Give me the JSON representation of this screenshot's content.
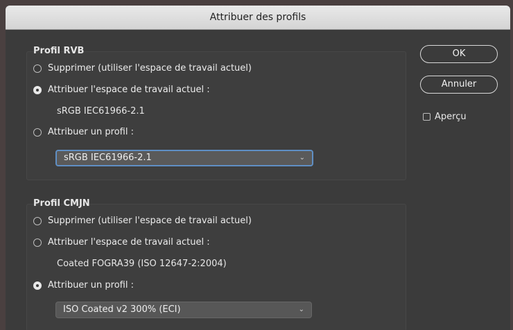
{
  "window": {
    "title": "Attribuer des profils"
  },
  "rgb": {
    "title": "Profil RVB",
    "option_discard": "Supprimer (utiliser l'espace de travail actuel)",
    "option_working": "Attribuer l'espace de travail actuel :",
    "working_space": "sRGB IEC61966-2.1",
    "option_profile": "Attribuer un profil :",
    "profile_selected": "sRGB IEC61966-2.1",
    "selected_option": "option_working"
  },
  "cmyk": {
    "title": "Profil CMJN",
    "option_discard": "Supprimer (utiliser l'espace de travail actuel)",
    "option_working": "Attribuer l'espace de travail actuel :",
    "working_space": "Coated FOGRA39 (ISO 12647-2:2004)",
    "option_profile": "Attribuer un profil :",
    "profile_selected": "ISO Coated v2 300% (ECI)",
    "selected_option": "option_profile"
  },
  "buttons": {
    "ok": "OK",
    "cancel": "Annuler"
  },
  "preview": {
    "label": "Aperçu",
    "checked": false
  },
  "icons": {
    "dropdown": "chevron-down-icon"
  },
  "colors": {
    "dialog_bg": "#3b3b3b",
    "focus_ring": "#5f8fc4"
  }
}
